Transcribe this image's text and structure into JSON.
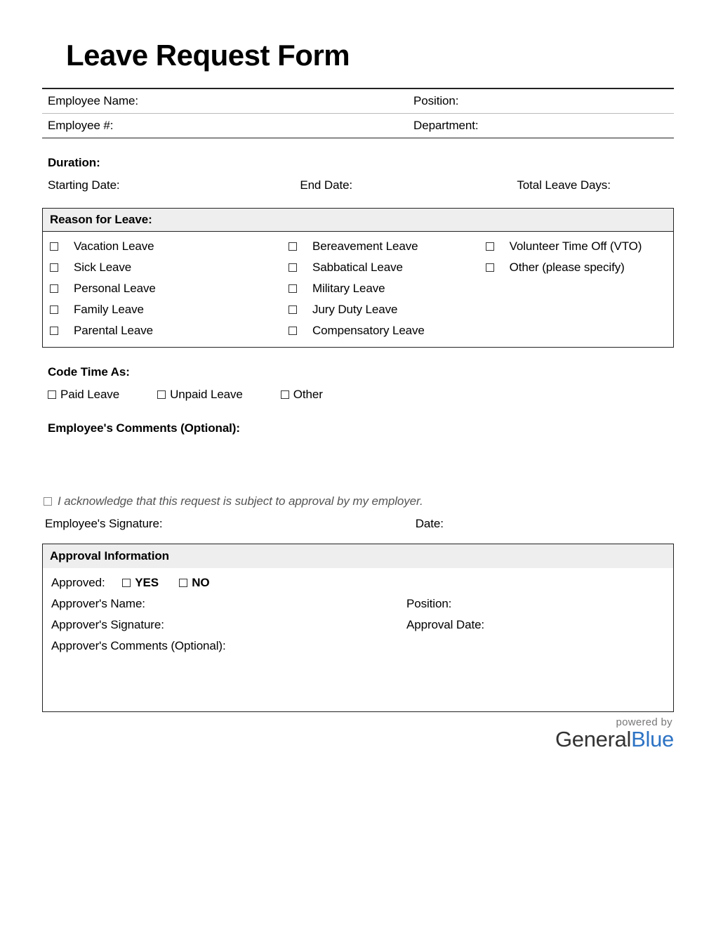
{
  "title": "Leave Request Form",
  "employee": {
    "name_label": "Employee Name:",
    "number_label": "Employee #:",
    "position_label": "Position:",
    "department_label": "Department:"
  },
  "duration": {
    "heading": "Duration:",
    "start_label": "Starting Date:",
    "end_label": "End Date:",
    "total_label": "Total Leave Days:"
  },
  "reason": {
    "heading": "Reason for Leave:",
    "col1": [
      "Vacation Leave",
      "Sick Leave",
      "Personal Leave",
      "Family Leave",
      "Parental Leave"
    ],
    "col2": [
      "Bereavement Leave",
      "Sabbatical Leave",
      "Military Leave",
      "Jury Duty Leave",
      "Compensatory Leave"
    ],
    "col3": [
      "Volunteer Time Off (VTO)",
      "Other (please specify)"
    ]
  },
  "code_time": {
    "heading": "Code Time As:",
    "options": [
      "Paid Leave",
      "Unpaid Leave",
      "Other"
    ]
  },
  "comments_heading": "Employee's Comments (Optional):",
  "ack_text": "I acknowledge that this request is subject to approval by my employer.",
  "signature": {
    "emp_sig_label": "Employee's Signature:",
    "date_label": "Date:"
  },
  "approval": {
    "heading": "Approval Information",
    "approved_label": "Approved:",
    "yes": "YES",
    "no": "NO",
    "approver_name_label": "Approver's Name:",
    "position_label": "Position:",
    "approver_sig_label": "Approver's Signature:",
    "approval_date_label": "Approval Date:",
    "approver_comments_label": "Approver's Comments (Optional):"
  },
  "footer": {
    "powered": "powered by",
    "brand_general": "General",
    "brand_blue": "Blue"
  }
}
